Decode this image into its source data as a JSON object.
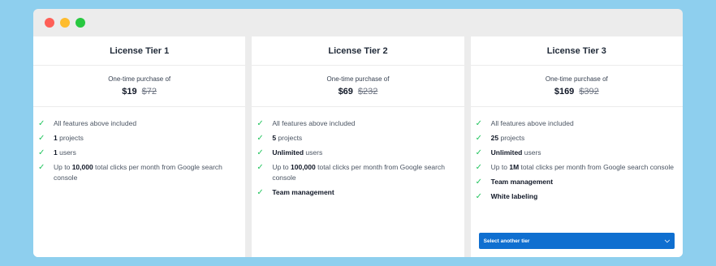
{
  "window": {
    "controls": [
      "close",
      "minimize",
      "zoom"
    ]
  },
  "tiers": [
    {
      "title": "License Tier 1",
      "caption": "One-time purchase of",
      "price": "$19",
      "old_price": "$72",
      "features": [
        {
          "pre": "",
          "bold": "",
          "post": "All features above included"
        },
        {
          "pre": "",
          "bold": "1",
          "post": " projects"
        },
        {
          "pre": "",
          "bold": "1",
          "post": " users"
        },
        {
          "pre": "Up to ",
          "bold": "10,000",
          "post": " total clicks per month from Google search console"
        }
      ]
    },
    {
      "title": "License Tier 2",
      "caption": "One-time purchase of",
      "price": "$69",
      "old_price": "$232",
      "features": [
        {
          "pre": "",
          "bold": "",
          "post": "All features above included"
        },
        {
          "pre": "",
          "bold": "5",
          "post": " projects"
        },
        {
          "pre": "",
          "bold": "Unlimited",
          "post": " users"
        },
        {
          "pre": "Up to ",
          "bold": "100,000",
          "post": " total clicks per month from Google search console"
        },
        {
          "pre": "",
          "bold": "Team management",
          "post": ""
        }
      ]
    },
    {
      "title": "License Tier 3",
      "caption": "One-time purchase of",
      "price": "$169",
      "old_price": "$392",
      "features": [
        {
          "pre": "",
          "bold": "",
          "post": "All features above included"
        },
        {
          "pre": "",
          "bold": "25",
          "post": " projects"
        },
        {
          "pre": "",
          "bold": "Unlimited",
          "post": " users"
        },
        {
          "pre": "Up to ",
          "bold": "1M",
          "post": " total clicks per month from Google search console"
        },
        {
          "pre": "",
          "bold": "Team management",
          "post": ""
        },
        {
          "pre": "",
          "bold": "White labeling",
          "post": ""
        }
      ],
      "select_label": "Select another tier"
    }
  ],
  "colors": {
    "background": "#8ecfee",
    "check": "#22c55e",
    "select_button": "#0f6fd0"
  },
  "icons": {
    "check": "check-icon",
    "chevron": "chevron-down-icon"
  }
}
